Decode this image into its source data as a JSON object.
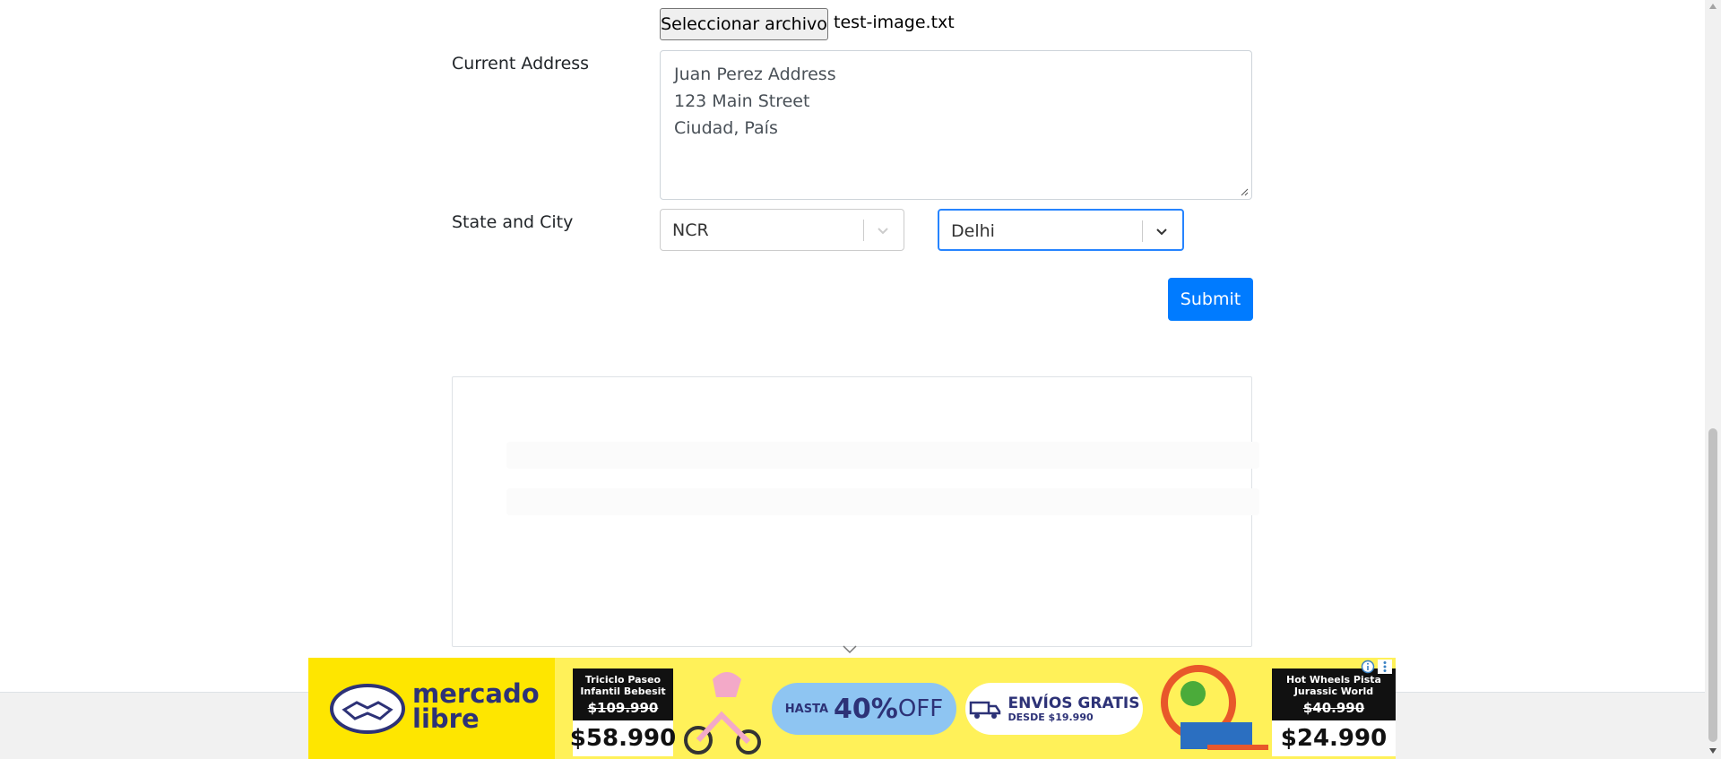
{
  "form": {
    "file_button_label": "Seleccionar archivo",
    "file_name": "test-image.txt",
    "current_address_label": "Current Address",
    "current_address_lines": [
      "Juan Perez Address",
      "123 Main Street",
      "Ciudad, País"
    ],
    "state_city_label": "State and City",
    "state_value": "NCR",
    "city_value": "Delhi",
    "submit_label": "Submit"
  },
  "ad": {
    "brand_line1": "mercado",
    "brand_line2": "libre",
    "product1_name_line1": "Triciclo Paseo",
    "product1_name_line2": "Infantil Bebesit",
    "product1_old_price": "$109.990",
    "product1_price": "$58.990",
    "promo_prefix": "HASTA",
    "promo_percent": "40%",
    "promo_suffix": "OFF",
    "shipping_title": "ENVÍOS GRATIS",
    "shipping_sub": "DESDE $19.990",
    "product2_name_line1": "Hot Wheels Pista",
    "product2_name_line2": "Jurassic World",
    "product2_old_price": "$40.990",
    "product2_price": "$24.990"
  },
  "colors": {
    "primary": "#007bff",
    "focus": "#2684ff",
    "ad_yellow": "#fee600"
  }
}
